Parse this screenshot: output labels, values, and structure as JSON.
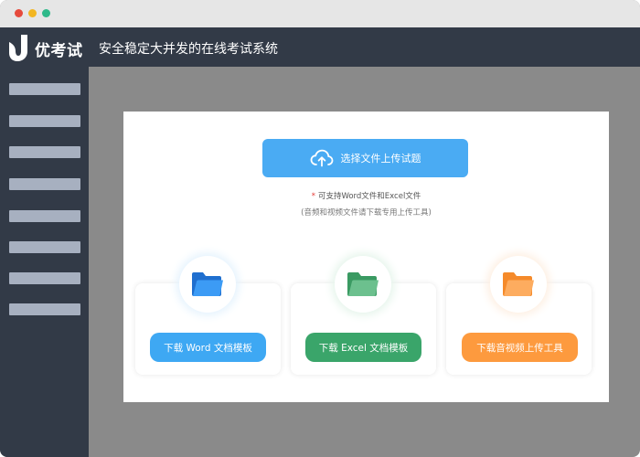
{
  "header": {
    "brand": "优考试",
    "slogan": "安全稳定大并发的在线考试系统"
  },
  "sidebar": {
    "item_count": 8
  },
  "upload": {
    "button_label": "选择文件上传试题",
    "hint_star": "*",
    "hint_main": "可支持Word文件和Excel文件",
    "hint_sub": "(音频和视频文件请下载专用上传工具)"
  },
  "templates": [
    {
      "label": "下载 Word 文档模板",
      "color": "#3ea8f3",
      "icon": "folder-icon-blue",
      "icon_color": "#2d8ef0",
      "glow": "#e3f2fd"
    },
    {
      "label": "下载 Excel 文档模板",
      "color": "#3aa56a",
      "icon": "folder-icon-green",
      "icon_color": "#4cae74",
      "glow": "#e4f4ea"
    },
    {
      "label": "下载音视频上传工具",
      "color": "#fd9a3e",
      "icon": "folder-icon-orange",
      "icon_color": "#fb9a40",
      "glow": "#fdeee0"
    }
  ],
  "colors": {
    "window_frame": "#e6e6e6",
    "header_bg": "#323a47",
    "sidebar_placeholder": "#a7b0c0",
    "workspace_bg": "#8a8a8a",
    "upload_button": "#4aabf3"
  }
}
